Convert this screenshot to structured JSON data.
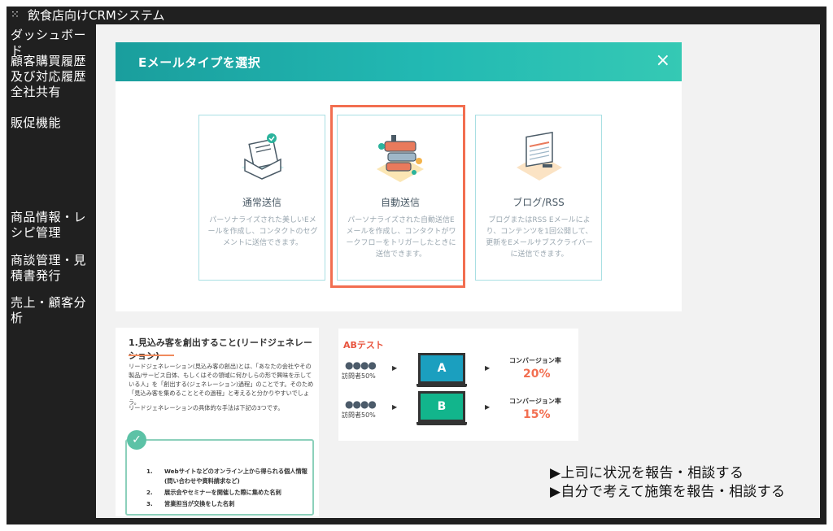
{
  "app": {
    "title": "飲食店向けCRMシステム",
    "logo_icon": "network-icon"
  },
  "sidebar": {
    "items": [
      {
        "label": "ダッシュボード"
      },
      {
        "label": "顧客購買履歴及び対応履歴全社共有"
      },
      {
        "label": "販促機能"
      },
      {
        "label": "商品情報・レシピ管理"
      },
      {
        "label": "商談管理・見積書発行"
      },
      {
        "label": "売上・顧客分析"
      }
    ]
  },
  "modal": {
    "title": "Eメールタイプを選択",
    "close_label": "×",
    "cards": [
      {
        "title": "通常送信",
        "desc": "パーソナライズされた美しいEメールを作成し、コンタクトのセグメントに送信できます。",
        "icon": "envelope-icon"
      },
      {
        "title": "自動送信",
        "desc": "パーソナライズされた自動送信Eメールを作成し、コンタクトがワークフローをトリガーしたときに送信できます。",
        "icon": "workflow-icon",
        "selected": true
      },
      {
        "title": "ブログ/RSS",
        "desc": "ブログまたはRSS Eメールにより、コンテンツを1回公開して、更新をEメールサブスクライバーに送信できます。",
        "icon": "blog-rss-icon"
      }
    ]
  },
  "leadgen": {
    "title": "1.見込み客を創出すること(リードジェネレーション)",
    "p1": "リードジェネレーション(見込み客の創出)とは、「あなたの会社やその製品/サービス自体、もしくはその領域に何かしらの形で興味を示している人」を「創出する(ジェネレーション)過程」のことです。そのため「見込み客を集めることとその過程」と考えると分かりやすいでしょう。",
    "p2": "リードジェネレーションの具体的な手法は下記の3つです。",
    "items": [
      {
        "num": "1.",
        "text": "Webサイトなどのオンライン上から得られる個人情報(問い合わせや資料請求など)"
      },
      {
        "num": "2.",
        "text": "展示会やセミナーを開催した際に集めた名刺"
      },
      {
        "num": "3.",
        "text": "営業担当が交換をした名刺"
      }
    ]
  },
  "abtest": {
    "title": "ABテスト",
    "rows": [
      {
        "visitors": "訪問者50%",
        "variant": "A",
        "screen_color": "#1b9fbf",
        "conversion_label": "コンバージョン率",
        "rate": "20%"
      },
      {
        "visitors": "訪問者50%",
        "variant": "B",
        "screen_color": "#12b58c",
        "conversion_label": "コンバージョン率",
        "rate": "15%"
      }
    ]
  },
  "notes": {
    "line1": "▶上司に状況を報告・相談する",
    "line2": "▶自分で考えて施策を報告・相談する"
  },
  "colors": {
    "dark": "#202020",
    "teal": "#22b9b3",
    "highlight": "#f26e50"
  }
}
